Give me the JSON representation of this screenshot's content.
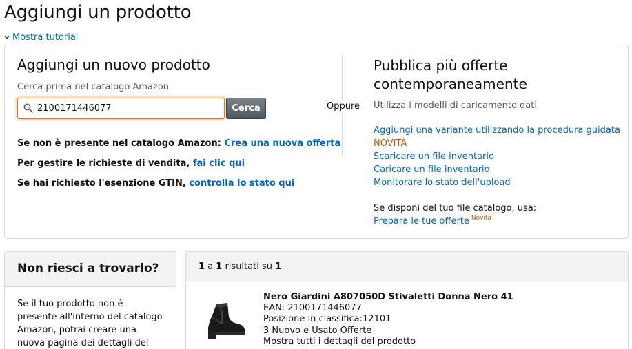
{
  "page": {
    "title": "Aggiungi un prodotto",
    "tutorial_link": "Mostra tutorial"
  },
  "left": {
    "title": "Aggiungi un nuovo prodotto",
    "search_hint": "Cerca prima nel catalogo Amazon",
    "search_value": "2100171446077",
    "search_button": "Cerca",
    "line1_text": "Se non è presente nel catalogo Amazon:",
    "line1_link": "Crea una nuova offerta",
    "line2_text": "Per gestire le richieste di vendita,",
    "line2_link": "fai clic qui",
    "line3_text": "Se hai richiesto l'esenzione GTIN,",
    "line3_link": "controlla lo stato qui"
  },
  "divider_label": "Oppure",
  "right": {
    "title": "Pubblica più offerte contemporaneamente",
    "hint": "Utilizza i modelli di caricamento dati",
    "link_variant": "Aggiungi una variante utilizzando la procedura guidata",
    "novita": "NOVITÀ",
    "link_download": "Scaricare un file inventario",
    "link_upload": "Caricare un file inventario",
    "link_monitor": "Monitorare lo stato dell'upload",
    "catalog_hint": "Se disponi del tuo file catalogo, usa:",
    "link_prepare": "Prepara le tue offerte",
    "novita_small": "Novità"
  },
  "help": {
    "title": "Non riesci a trovarlo?",
    "text": "Se il tuo prodotto non è presente all'interno del catalogo Amazon, potrai creare una nuova pagina dei dettagli del prodotto."
  },
  "results": {
    "from": "1",
    "sep1": " a ",
    "to": "1",
    "sep2": " risultati su ",
    "total": "1",
    "product": {
      "title": "Nero Giardini A807050D Stivaletti Donna Nero 41",
      "ean": "EAN: 2100171446077",
      "rank": "Posizione in classifica:12101",
      "offers": "3 Nuovo e Usato Offerte",
      "details_link": "Mostra tutti i dettagli del prodotto",
      "image": "black-ankle-boot"
    }
  },
  "colors": {
    "link": "#0066c0",
    "accent": "#c45500",
    "focus": "#e77600"
  }
}
